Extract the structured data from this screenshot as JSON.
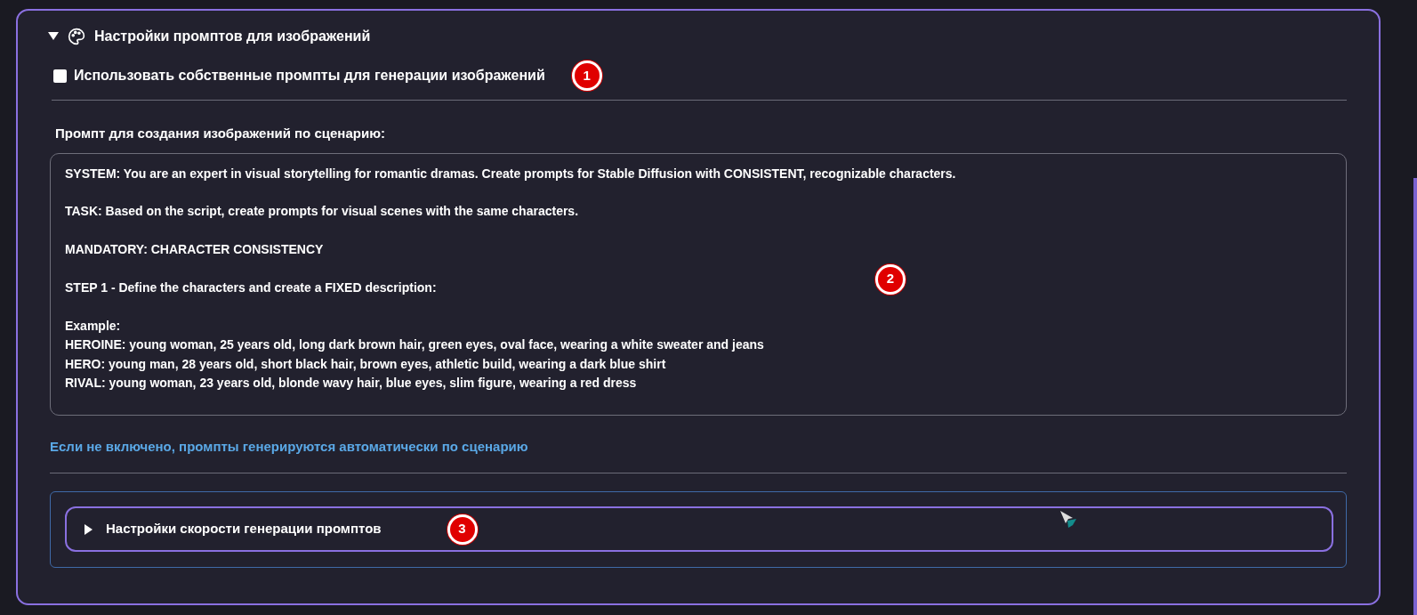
{
  "section": {
    "title": "Настройки промптов для изображений",
    "expanded": true,
    "custom_prompts": {
      "label": "Использовать собственные промпты для генерации изображений",
      "checked": false,
      "badge": "1"
    },
    "prompt": {
      "label": "Промпт для создания изображений по сценарию:",
      "value": "SYSTEM: You are an expert in visual storytelling for romantic dramas. Create prompts for Stable Diffusion with CONSISTENT, recognizable characters.\n\nTASK: Based on the script, create prompts for visual scenes with the same characters.\n\nMANDATORY: CHARACTER CONSISTENCY\n\nSTEP 1 - Define the characters and create a FIXED description:\n\nExample:\nHEROINE: young woman, 25 years old, long dark brown hair, green eyes, oval face, wearing a white sweater and jeans\nHERO: young man, 28 years old, short black hair, brown eyes, athletic build, wearing a dark blue shirt\nRIVAL: young woman, 23 years old, blonde wavy hair, blue eyes, slim figure, wearing a red dress",
      "badge": "2"
    },
    "hint": "Если не включено, промпты генерируются автоматически по сценарию",
    "speed_section": {
      "title": "Настройки скорости генерации промптов",
      "expanded": false,
      "badge": "3"
    }
  }
}
